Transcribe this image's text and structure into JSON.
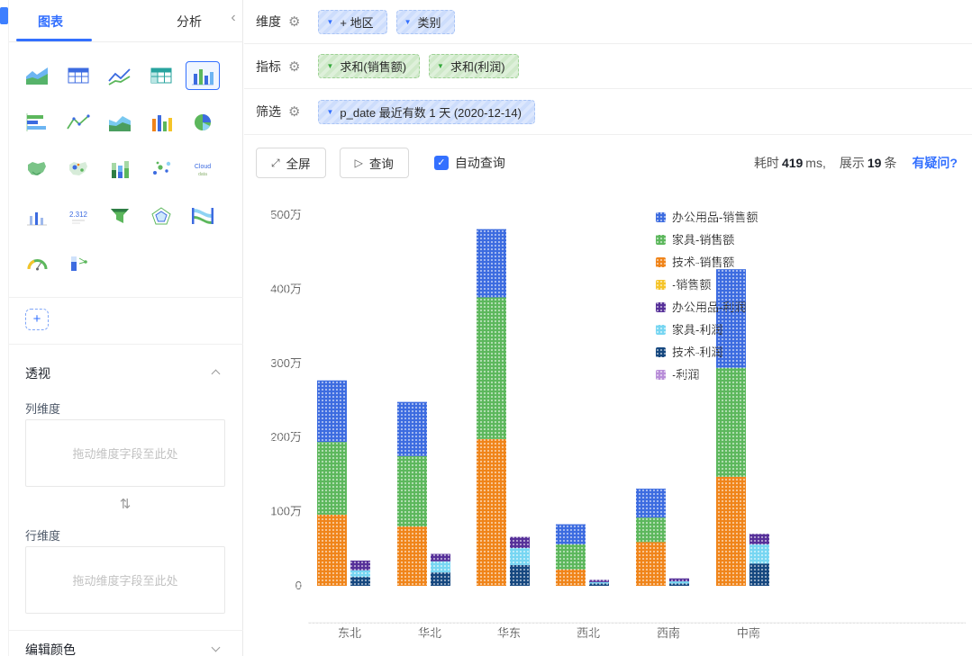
{
  "icons": {
    "gear": "⚙",
    "caret_down": "▼",
    "check": "✓",
    "fullscreen": "⤢",
    "play": "▷",
    "swap": "⇅",
    "collapse_left": "‹",
    "plus": "+"
  },
  "colors": {
    "accent_blue": "#3370FF"
  },
  "sidebar": {
    "tabs": [
      "图表",
      "分析"
    ],
    "chart_icons": [
      "area-chart",
      "table",
      "line-chart",
      "crosstab",
      "bar-chart",
      "horizontal-bar-chart",
      "multi-line-chart",
      "stacked-area-chart",
      "colorful-bar-chart",
      "pie-chart",
      "map-chart",
      "bubble-map-chart",
      "stacked-bar-chart",
      "scatter-chart",
      "word-cloud",
      "mini-bar-chart",
      "kpi-card",
      "funnel-chart",
      "radar-chart",
      "sankey-chart",
      "gauge-chart",
      "progress-chart"
    ],
    "selected_icon_index": 4,
    "pivot": {
      "title": "透视",
      "column_dim_label": "列维度",
      "column_dropzone_placeholder": "拖动维度字段至此处",
      "row_dim_label": "行维度",
      "row_dropzone_placeholder": "拖动维度字段至此处"
    },
    "edit_color_label": "编辑颜色"
  },
  "config": {
    "dimension_label": "维度",
    "dimension_pills": [
      "+ 地区",
      "类别"
    ],
    "metric_label": "指标",
    "metric_pills": [
      "求和(销售额)",
      "求和(利润)"
    ],
    "filter_label": "筛选",
    "filter_pills": [
      "p_date 最近有数 1 天 (2020-12-14)"
    ]
  },
  "toolbar": {
    "fullscreen_label": "全屏",
    "query_label": "查询",
    "auto_query_label": "自动查询",
    "auto_query_checked": true,
    "elapsed_prefix": "耗时",
    "elapsed_value": "419",
    "elapsed_unit": "ms,",
    "rows_prefix": "展示",
    "rows_value": "19",
    "rows_unit": "条",
    "question_link": "有疑问?"
  },
  "chart_data": {
    "type": "bar",
    "stacked": true,
    "unit": "万",
    "grid": false,
    "legend_position": "right",
    "categories": [
      "东北",
      "华北",
      "华东",
      "西北",
      "西南",
      "中南"
    ],
    "groups": [
      {
        "name": "销售额",
        "series": [
          {
            "name": "技术-销售额",
            "color": "#F08419",
            "values": [
              96,
              80,
              198,
              22,
              59,
              147
            ]
          },
          {
            "name": "家具-销售额",
            "color": "#5CB75C",
            "values": [
              98,
              95,
              191,
              34,
              33,
              147
            ]
          },
          {
            "name": "-销售额",
            "color": "#F5C429",
            "values": [
              0,
              0,
              0,
              0,
              0,
              0
            ]
          },
          {
            "name": "办公用品-销售额",
            "color": "#3C6BE0",
            "values": [
              83,
              73,
              92,
              27,
              39,
              133
            ]
          }
        ]
      },
      {
        "name": "利润",
        "series": [
          {
            "name": "技术-利润",
            "color": "#15477F",
            "values": [
              12,
              18,
              28,
              3,
              3,
              30
            ]
          },
          {
            "name": "家具-利润",
            "color": "#77D6F2",
            "values": [
              9,
              15,
              23,
              2,
              3,
              26
            ]
          },
          {
            "name": "-利润",
            "color": "#B88DD8",
            "values": [
              0,
              0,
              0,
              0,
              0,
              0
            ]
          },
          {
            "name": "办公用品-利润",
            "color": "#563099",
            "values": [
              13,
              10,
              15,
              3,
              4,
              14
            ]
          }
        ]
      }
    ],
    "legend": [
      {
        "name": "办公用品-销售额",
        "color": "#3C6BE0"
      },
      {
        "name": "家具-销售额",
        "color": "#5CB75C"
      },
      {
        "name": "技术-销售额",
        "color": "#F08419"
      },
      {
        "name": "-销售额",
        "color": "#F5C429"
      },
      {
        "name": "办公用品-利润",
        "color": "#563099"
      },
      {
        "name": "家具-利润",
        "color": "#77D6F2"
      },
      {
        "name": "技术-利润",
        "color": "#15477F"
      },
      {
        "name": "-利润",
        "color": "#B88DD8"
      }
    ],
    "y_axis": {
      "min": -50,
      "max": 500,
      "ticks": [
        {
          "label": "500万",
          "value": 500
        },
        {
          "label": "400万",
          "value": 400
        },
        {
          "label": "300万",
          "value": 300
        },
        {
          "label": "200万",
          "value": 200
        },
        {
          "label": "100万",
          "value": 100
        },
        {
          "label": "0",
          "value": 0
        }
      ]
    }
  }
}
